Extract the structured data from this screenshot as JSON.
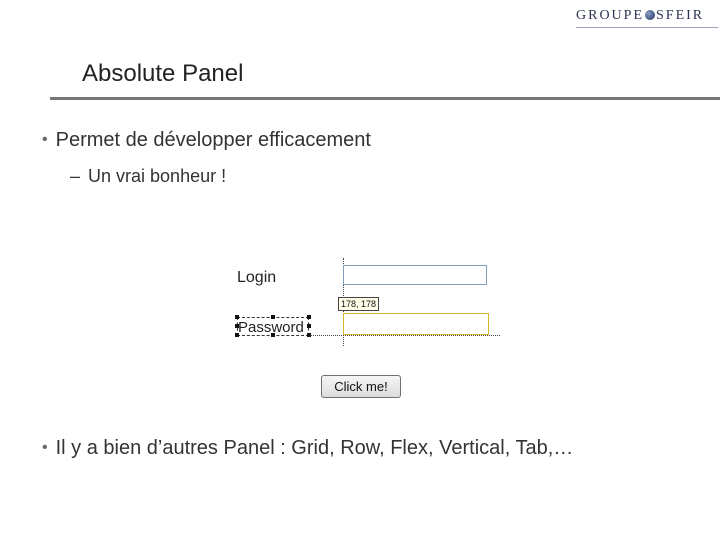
{
  "logo": {
    "name_part1": "GROUPE",
    "name_part2": "SFEIR",
    "icon": "globe-dot-icon"
  },
  "slide": {
    "title": "Absolute Panel",
    "bullets": [
      {
        "text": "Permet de développer efficacement",
        "sub": "Un vrai bonheur !"
      },
      {
        "text": "Il y a bien d’autres Panel : Grid, Row, Flex, Vertical, Tab,…"
      }
    ]
  },
  "designer": {
    "login_label": "Login",
    "password_label": "Password",
    "coordinates": "178, 178",
    "button_label": "Click me!",
    "colors": {
      "input_border": "#7f9db9",
      "focused_border": "#d4b828"
    }
  }
}
